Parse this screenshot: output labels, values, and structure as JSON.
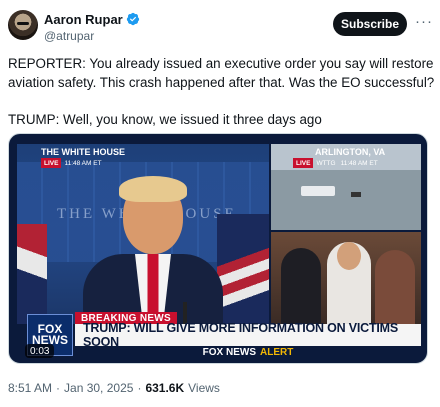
{
  "author": {
    "name": "Aaron Rupar",
    "handle": "@atrupar",
    "verified_icon": "verified-badge-icon"
  },
  "actions": {
    "subscribe_label": "Subscribe",
    "more_label": "···"
  },
  "tweet": {
    "paragraph_1": "REPORTER: You already issued an executive order you say will restore aviation safety. This crash happened after that. Was the EO successful?",
    "paragraph_2": "TRUMP: Well, you know, we issued it three days ago"
  },
  "video": {
    "left_location": "THE WHITE HOUSE",
    "left_live": "LIVE",
    "left_time": "11:48 AM ET",
    "backdrop_text": "THE WHITE HOUSE",
    "right_location": "ARLINGTON, VA",
    "right_live": "LIVE",
    "right_station": "WTTG",
    "right_time": "11:48 AM ET",
    "breaking_label": "BREAKING NEWS",
    "headline": "TRUMP: WILL GIVE MORE INFORMATION ON VICTIMS SOON",
    "alert_brand": "FOX NEWS",
    "alert_word": "ALERT",
    "network_logo_line1": "FOX",
    "network_logo_line2": "NEWS",
    "duration": "0:03"
  },
  "footer": {
    "time": "8:51 AM",
    "separator": "·",
    "date": "Jan 30, 2025",
    "separator2": "·",
    "views_count": "631.6K",
    "views_label": "Views"
  },
  "colors": {
    "accent_blue": "#1d9bf0",
    "fox_red": "#c8102e",
    "fox_navy": "#0b1a3b",
    "alert_yellow": "#f2b705"
  }
}
